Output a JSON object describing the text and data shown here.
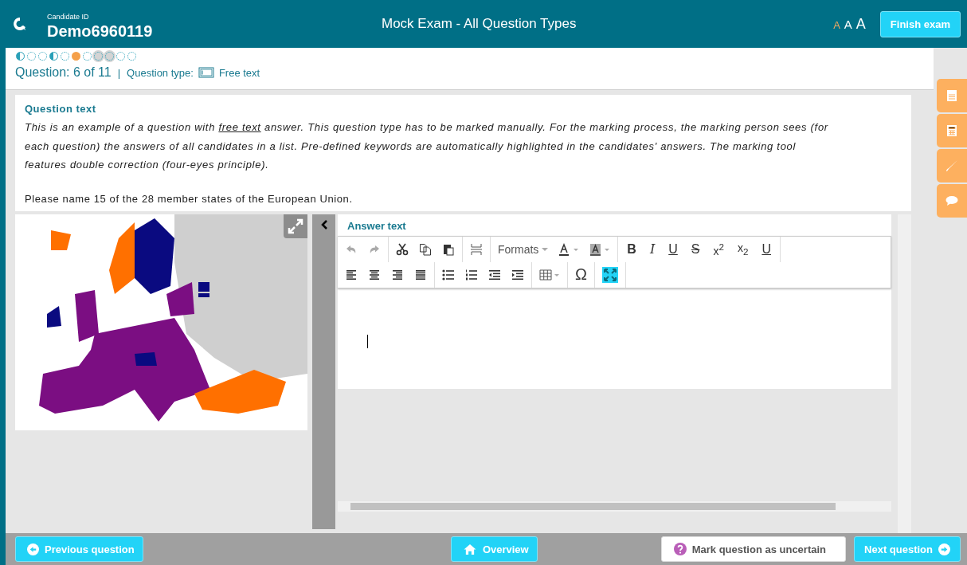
{
  "header": {
    "candidate_label": "Candidate ID",
    "candidate_id": "Demo6960119",
    "title": "Mock Exam - All Question Types",
    "font_sizes": [
      {
        "label": "A",
        "selected": true
      },
      {
        "label": "A",
        "selected": false
      },
      {
        "label": "A",
        "selected": false
      }
    ],
    "finish_button": "Finish exam"
  },
  "progress": [
    {
      "kind": "partial",
      "selected": false,
      "marked": false
    },
    {
      "kind": "open",
      "selected": false,
      "marked": false
    },
    {
      "kind": "open",
      "selected": false,
      "marked": false
    },
    {
      "kind": "partial",
      "selected": false,
      "marked": false
    },
    {
      "kind": "open",
      "selected": false,
      "marked": false
    },
    {
      "kind": "open",
      "selected": true,
      "marked": false
    },
    {
      "kind": "open",
      "selected": false,
      "marked": false
    },
    {
      "kind": "open",
      "selected": false,
      "marked": true
    },
    {
      "kind": "open",
      "selected": false,
      "marked": true
    },
    {
      "kind": "open",
      "selected": false,
      "marked": false
    },
    {
      "kind": "open",
      "selected": false,
      "marked": false
    }
  ],
  "question_info": {
    "counter": "Question: 6 of 11",
    "separator": "|",
    "type_label": "Question type:",
    "type_value": "Free text"
  },
  "question": {
    "heading": "Question text",
    "intro": [
      {
        "kind": "text",
        "text": "This is an example of a question with "
      },
      {
        "kind": "link",
        "text": "free text"
      },
      {
        "kind": "text",
        "text": " answer. This question type has to be marked manually. For the marking process, the marking person sees (for each question) the answers of all candidates in a list. Pre-defined keywords are automatically highlighted in the candidates' answers. The marking tool features double correction (four-eyes principle)."
      }
    ],
    "prompt": "Please name 15 of the 28 member states of the European Union."
  },
  "answer": {
    "heading": "Answer text",
    "toolbar": {
      "undo_disabled": true,
      "redo_disabled": true,
      "formats": "Formats",
      "text_buttons": [
        "B",
        "I",
        "U",
        "S",
        "x$^{2}$",
        "x$_{2}$",
        "U"
      ],
      "symbol": "Ω",
      "fullscreen_active": true
    }
  },
  "footer": {
    "previous": "Previous question",
    "overview": "Overview",
    "mark": "Mark question as uncertain",
    "next": "Next question"
  }
}
